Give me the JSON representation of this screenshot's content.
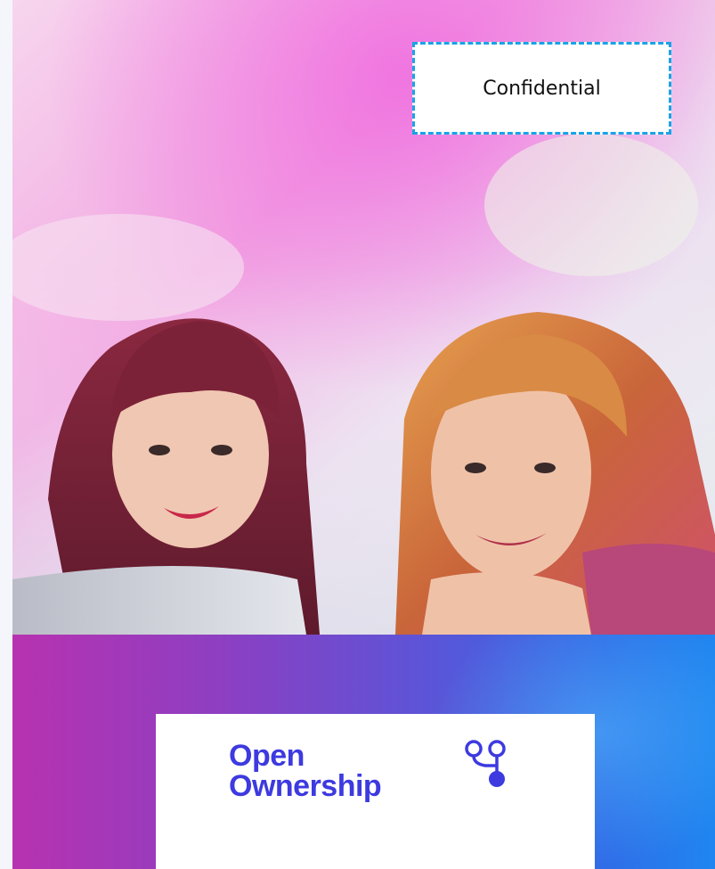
{
  "stamp": {
    "label": "Confidential"
  },
  "logo": {
    "line1": "Open",
    "line2": "Ownership",
    "icon": "ownership-graph-icon"
  },
  "colors": {
    "brand": "#3d3ae0",
    "stamp_border": "#1aa3e6",
    "band_start": "#b732b0",
    "band_end": "#1f86f0"
  }
}
